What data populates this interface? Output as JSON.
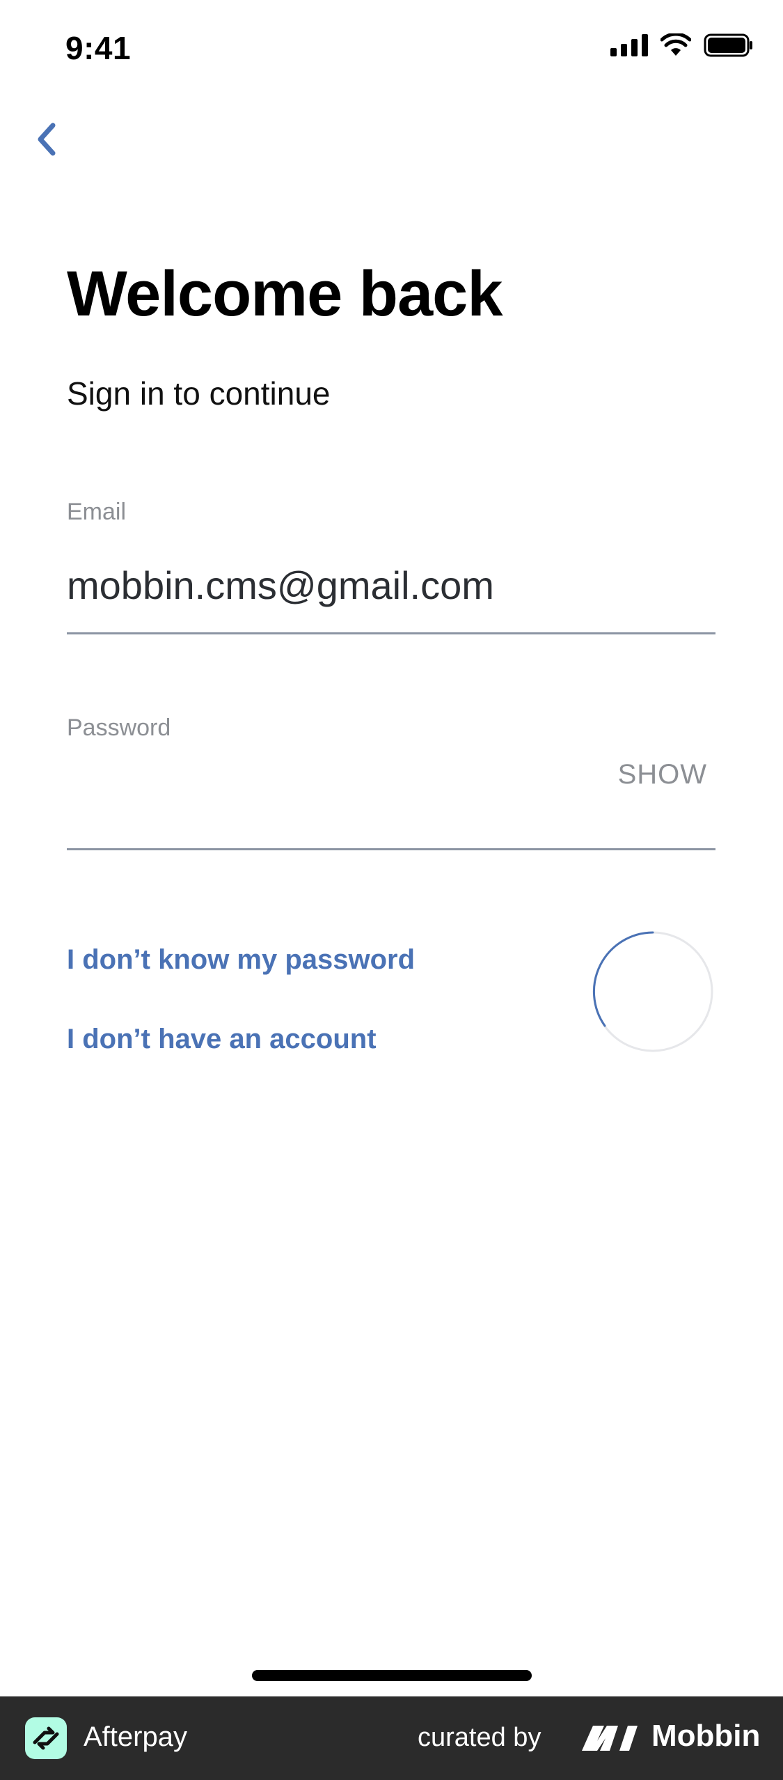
{
  "status_bar": {
    "time": "9:41"
  },
  "header": {
    "back_icon": "chevron-left-icon"
  },
  "content": {
    "title": "Welcome back",
    "subtitle": "Sign in to continue"
  },
  "form": {
    "email_label": "Email",
    "email_value": "mobbin.cms@gmail.com",
    "password_label": "Password",
    "password_value": "",
    "show_label": "SHOW"
  },
  "links": {
    "forgot_password": "I don’t know my password",
    "no_account": "I don’t have an account"
  },
  "footer": {
    "app_name": "Afterpay",
    "curated_by": "curated by",
    "curator": "Mobbin"
  },
  "colors": {
    "accent": "#4a72b5",
    "label_gray": "#8c8f94",
    "underline": "#8b94a3",
    "footer_bg": "#2b2b2b",
    "brand_mint": "#b2fce4"
  }
}
